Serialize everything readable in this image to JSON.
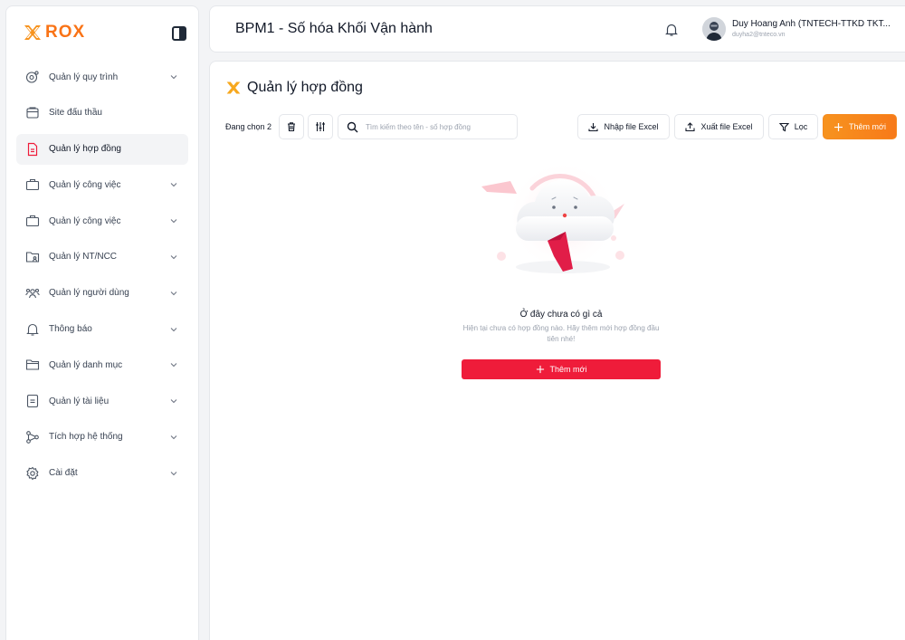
{
  "brand": {
    "name": "ROX",
    "accent": "#f97316"
  },
  "sidebar": {
    "items": [
      {
        "label": "Quản lý quy trình",
        "icon": "settings-search-icon",
        "expandable": true,
        "active": false
      },
      {
        "label": "Site đấu thầu",
        "icon": "window-icon",
        "expandable": false,
        "active": false
      },
      {
        "label": "Quản lý hợp đồng",
        "icon": "document-icon",
        "expandable": false,
        "active": true
      },
      {
        "label": "Quản lý công việc",
        "icon": "briefcase-icon",
        "expandable": true,
        "active": false
      },
      {
        "label": "Quản lý công việc",
        "icon": "briefcase-icon",
        "expandable": true,
        "active": false
      },
      {
        "label": "Quản lý NT/NCC",
        "icon": "folder-user-icon",
        "expandable": true,
        "active": false
      },
      {
        "label": "Quản lý người dùng",
        "icon": "users-icon",
        "expandable": true,
        "active": false
      },
      {
        "label": "Thông báo",
        "icon": "bell-icon",
        "expandable": true,
        "active": false
      },
      {
        "label": "Quản lý danh mục",
        "icon": "folder-icon",
        "expandable": true,
        "active": false
      },
      {
        "label": "Quản lý tài liệu",
        "icon": "file-text-icon",
        "expandable": true,
        "active": false
      },
      {
        "label": "Tích hợp hệ thống",
        "icon": "integration-icon",
        "expandable": true,
        "active": false
      },
      {
        "label": "Cài đặt",
        "icon": "gear-icon",
        "expandable": true,
        "active": false
      }
    ]
  },
  "header": {
    "title": "BPM1 - Số hóa Khối Vận hành",
    "user_name": "Duy Hoang Anh (TNTECH-TTKD TKT...",
    "user_email": "duyha2@tnteco.vn"
  },
  "content": {
    "title": "Quản lý hợp đồng",
    "selected_text": "Đang chọn 2",
    "search_placeholder": "Tìm kiếm theo tên - số hợp đồng",
    "import_label": "Nhập file Excel",
    "export_label": "Xuất file Excel",
    "filter_label": "Lọc",
    "add_label": "Thêm mới",
    "empty": {
      "title": "Ở đây chưa có gì cả",
      "description": "Hiện tại chưa có hợp đồng nào. Hãy thêm mới hợp đồng đầu tiên nhé!",
      "button_label": "Thêm mới"
    }
  },
  "colors": {
    "primary_gradient_start": "#f7931e",
    "danger": "#ef1c3a"
  }
}
